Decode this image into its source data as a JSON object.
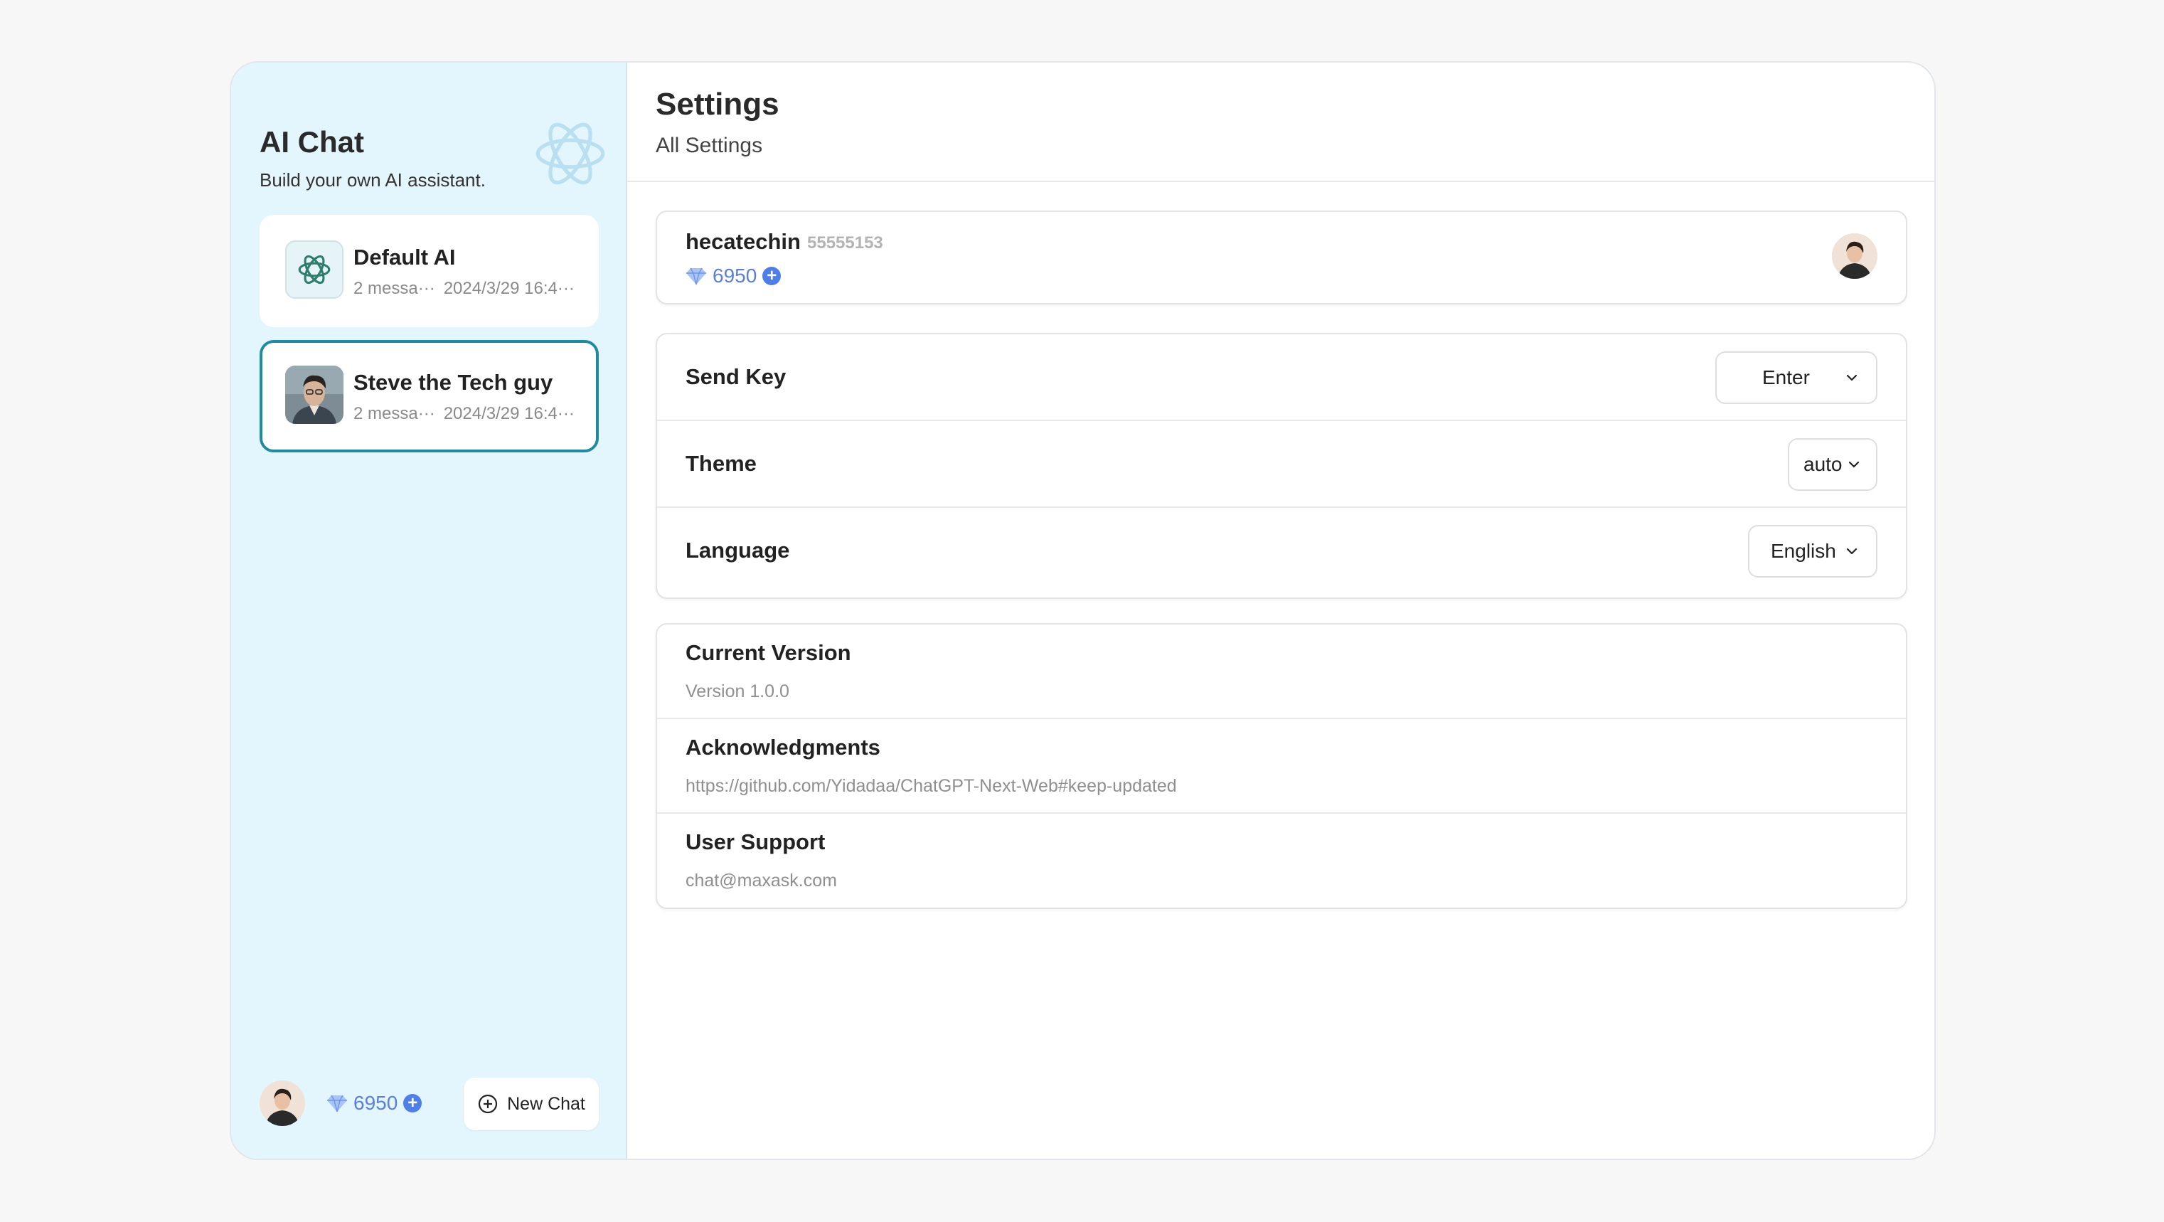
{
  "sidebar": {
    "title": "AI Chat",
    "subtitle": "Build your own AI assistant.",
    "chats": [
      {
        "title": "Default AI",
        "count": "2 messa···",
        "time": "2024/3/29 16:4···",
        "avatar": "openai-icon",
        "selected": false
      },
      {
        "title": "Steve the Tech guy",
        "count": "2 messa···",
        "time": "2024/3/29 16:4···",
        "avatar": "steve-portrait",
        "selected": true
      }
    ],
    "footer": {
      "balance": "6950",
      "new_chat_label": "New Chat"
    }
  },
  "header": {
    "title": "Settings",
    "subtitle": "All Settings",
    "buttons": [
      "logout-icon",
      "trash-icon",
      "refresh-icon",
      "close-icon"
    ]
  },
  "user": {
    "name": "hecatechin",
    "id": "55555153",
    "balance": "6950"
  },
  "settings": {
    "send_key": {
      "label": "Send Key",
      "value": "Enter"
    },
    "theme": {
      "label": "Theme",
      "value": "auto"
    },
    "language": {
      "label": "Language",
      "value": "English"
    }
  },
  "info": {
    "version": {
      "label": "Current Version",
      "value": "Version 1.0.0"
    },
    "acknowledgments": {
      "label": "Acknowledgments",
      "value": "https://github.com/Yidadaa/ChatGPT-Next-Web#keep-updated"
    },
    "support": {
      "label": "User Support",
      "value": "chat@maxask.com"
    }
  },
  "colors": {
    "sidebar_bg": "#e4f6fd",
    "accent": "#1f8aa0",
    "diamond": "#5b7fd6"
  }
}
